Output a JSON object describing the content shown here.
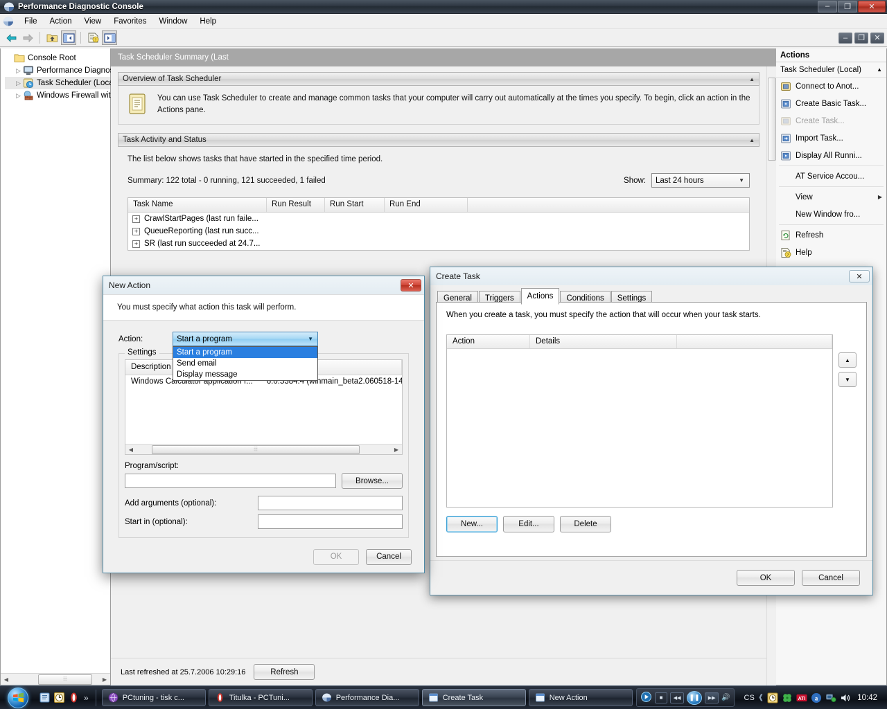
{
  "window": {
    "title": "Performance Diagnostic Console",
    "icon": "mmc-console-icon",
    "buttons": {
      "minimize": "–",
      "maximize": "❐",
      "close": "✕"
    }
  },
  "menu": {
    "items": [
      {
        "label": "File"
      },
      {
        "label": "Action"
      },
      {
        "label": "View"
      },
      {
        "label": "Favorites"
      },
      {
        "label": "Window"
      },
      {
        "label": "Help"
      }
    ]
  },
  "toolbar": {
    "buttons": [
      {
        "name": "back-icon",
        "label": "Back"
      },
      {
        "name": "forward-icon",
        "label": "Forward"
      },
      {
        "name": "up-one-level-icon",
        "label": "Up One Level"
      },
      {
        "name": "show-hide-tree-icon",
        "label": "Show/Hide Console Tree"
      },
      {
        "name": "properties-help-icon",
        "label": "Properties"
      },
      {
        "name": "show-action-pane-icon",
        "label": "Show/Hide Action Pane"
      }
    ]
  },
  "mdi_buttons": {
    "minimize": "–",
    "maximize": "❐",
    "close": "✕"
  },
  "tree": {
    "items": [
      {
        "label": "Console Root",
        "icon": "folder-icon",
        "twisty": "",
        "selected": false
      },
      {
        "label": "Performance Diagnos",
        "icon": "computer-icon",
        "twisty": "▷",
        "selected": false
      },
      {
        "label": "Task Scheduler  (Loca",
        "icon": "task-scheduler-icon",
        "twisty": "▷",
        "selected": true
      },
      {
        "label": "Windows Firewall wit",
        "icon": "firewall-icon",
        "twisty": "▷",
        "selected": false
      }
    ],
    "scrollbar": {
      "left_arrow": "◀",
      "right_arrow": "▶",
      "grip": "⦙⦙⦙"
    }
  },
  "result": {
    "header": "Task Scheduler Summary (Last",
    "overview": {
      "panel_title": "Overview of Task Scheduler",
      "collapse_glyph": "▲",
      "icon": "task-scheduler-large-icon",
      "text": "You can use Task Scheduler to create and manage common tasks that your computer will carry out automatically at the times you specify. To begin, click an action in the Actions pane."
    },
    "activity": {
      "panel_title": "Task Activity and Status",
      "collapse_glyph": "▲",
      "description": "The list below shows tasks that have started in the specified time period.",
      "summary": "Summary: 122 total - 0 running, 121 succeeded, 1 failed",
      "show_label": "Show:",
      "show_value": "Last 24 hours",
      "show_arrow": "▼"
    },
    "table": {
      "columns": [
        "Task Name",
        "Run Result",
        "Run Start",
        "Run End"
      ],
      "rows": [
        {
          "expander": "+",
          "name": "CrawlStartPages (last run faile..."
        },
        {
          "expander": "+",
          "name": "QueueReporting (last run succ..."
        },
        {
          "expander": "+",
          "name": "SR (last run succeeded at 24.7..."
        }
      ]
    },
    "status": {
      "last_refreshed": "Last refreshed at 25.7.2006 10:29:16",
      "refresh_button": "Refresh"
    }
  },
  "actions_pane": {
    "title": "Actions",
    "subtitle": "Task Scheduler  (Local)",
    "collapse_glyph": "▲",
    "items": [
      {
        "label": "Connect to Anot...",
        "icon": "connect-icon",
        "disabled": false,
        "submenu": ""
      },
      {
        "label": "Create Basic Task...",
        "icon": "create-basic-task-icon",
        "disabled": false,
        "submenu": ""
      },
      {
        "label": "Create Task...",
        "icon": "create-task-icon",
        "disabled": true,
        "submenu": ""
      },
      {
        "label": "Import Task...",
        "icon": "import-task-icon",
        "disabled": false,
        "submenu": ""
      },
      {
        "label": "Display All Runni...",
        "icon": "display-running-icon",
        "disabled": false,
        "submenu": ""
      },
      {
        "label": "AT Service Accou...",
        "icon": "",
        "disabled": false,
        "submenu": ""
      },
      {
        "label": "View",
        "icon": "",
        "disabled": false,
        "submenu": "▶"
      },
      {
        "label": "New Window fro...",
        "icon": "",
        "disabled": false,
        "submenu": ""
      },
      {
        "label": "Refresh",
        "icon": "refresh-icon",
        "disabled": false,
        "submenu": ""
      },
      {
        "label": "Help",
        "icon": "help-icon",
        "disabled": false,
        "submenu": ""
      }
    ]
  },
  "new_action_dialog": {
    "title": "New Action",
    "close_glyph": "✕",
    "banner": "You must specify what action this task will perform.",
    "action_label": "Action:",
    "action_value": "Start a program",
    "action_arrow": "▼",
    "dropdown_options": [
      {
        "label": "Start a program",
        "selected": true
      },
      {
        "label": "Send email",
        "selected": false
      },
      {
        "label": "Display message",
        "selected": false
      }
    ],
    "settings_legend": "Settings",
    "desc_columns": [
      "Description"
    ],
    "desc_row": {
      "description": "Windows Calculator application f...",
      "version": "6.0.5384.4 (winmain_beta2.060518-14"
    },
    "scroll_grip": "⦙⦙⦙",
    "program_label": "Program/script:",
    "program_value": "",
    "browse_button": "Browse...",
    "args_label": "Add arguments (optional):",
    "args_value": "",
    "startin_label": "Start in (optional):",
    "startin_value": "",
    "ok_button": "OK",
    "cancel_button": "Cancel"
  },
  "create_task_dialog": {
    "title": "Create Task",
    "close_glyph": "✕",
    "tabs": [
      {
        "label": "General",
        "active": false
      },
      {
        "label": "Triggers",
        "active": false
      },
      {
        "label": "Actions",
        "active": true
      },
      {
        "label": "Conditions",
        "active": false
      },
      {
        "label": "Settings",
        "active": false
      }
    ],
    "description": "When you create a task, you must specify the action that will occur when your task starts.",
    "list_columns": [
      "Action",
      "Details"
    ],
    "move_up_glyph": "▲",
    "move_down_glyph": "▼",
    "new_button": "New...",
    "edit_button": "Edit...",
    "delete_button": "Delete",
    "ok_button": "OK",
    "cancel_button": "Cancel"
  },
  "taskbar": {
    "start_label": "Start",
    "quicklaunch": [
      {
        "name": "show-desktop-icon"
      },
      {
        "name": "clock-gadget-icon"
      },
      {
        "name": "opera-icon"
      }
    ],
    "quicklaunch_chevron": "»",
    "tasks": [
      {
        "label": "PCtuning - tisk c...",
        "icon": "browser-icon",
        "active": false
      },
      {
        "label": "Titulka - PCTuni...",
        "icon": "opera-icon",
        "active": false
      },
      {
        "label": "Performance Dia...",
        "icon": "mmc-console-icon",
        "active": false
      },
      {
        "label": "Create Task",
        "icon": "window-icon",
        "active": true
      },
      {
        "label": "New Action",
        "icon": "window-icon",
        "active": false
      }
    ],
    "media_controls": {
      "stop": "■",
      "prev": "◀◀",
      "play_pause": "❚❚",
      "next": "▶▶",
      "volume": "🔊"
    },
    "tray": {
      "language": "CS",
      "icons": [
        {
          "name": "clock-tray-icon"
        },
        {
          "name": "clover-icon"
        },
        {
          "name": "ati-icon"
        },
        {
          "name": "acrobat-icon"
        },
        {
          "name": "network-icon"
        },
        {
          "name": "volume-icon"
        }
      ],
      "clock": "10:42"
    }
  }
}
